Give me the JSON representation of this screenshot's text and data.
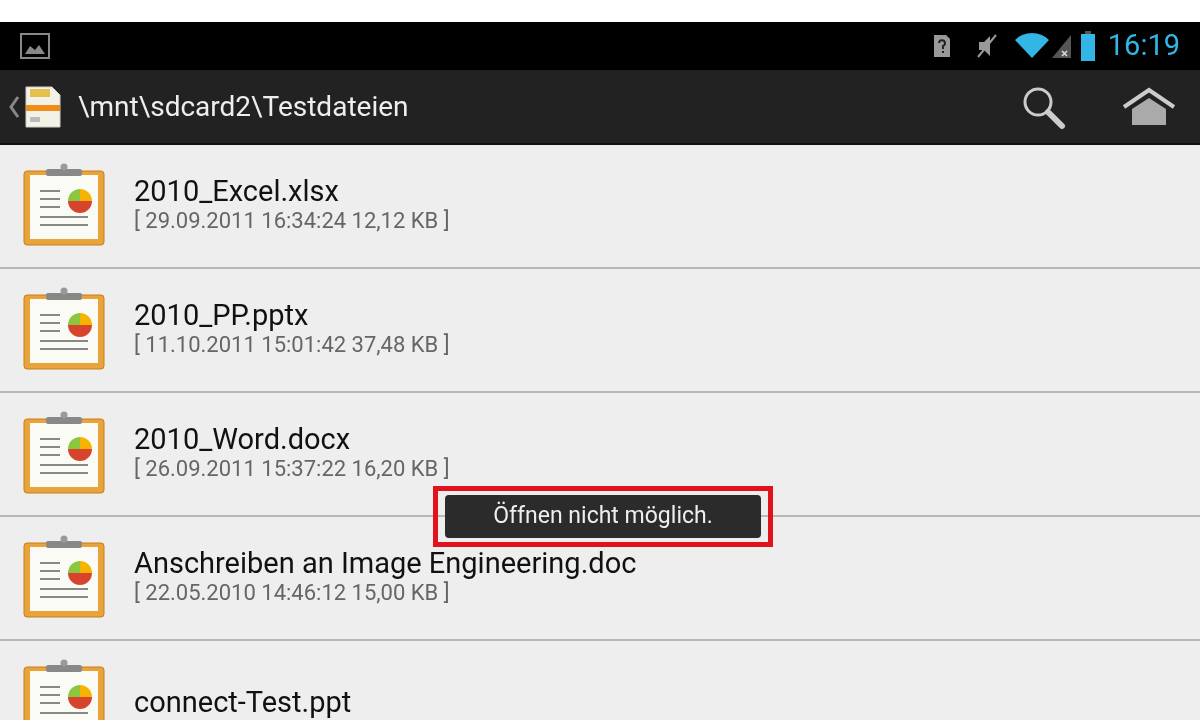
{
  "status_bar": {
    "time": "16:19"
  },
  "action_bar": {
    "path": "\\mnt\\sdcard2\\Testdateien"
  },
  "files": [
    {
      "name": "2010_Excel.xlsx",
      "meta": "[ 29.09.2011 16:34:24 12,12 KB ]"
    },
    {
      "name": "2010_PP.pptx",
      "meta": "[ 11.10.2011 15:01:42 37,48 KB ]"
    },
    {
      "name": "2010_Word.docx",
      "meta": "[ 26.09.2011 15:37:22 16,20 KB ]"
    },
    {
      "name": "Anschreiben an Image Engineering.doc",
      "meta": "[ 22.05.2010 14:46:12 15,00 KB ]"
    },
    {
      "name": "connect-Test.ppt"
    }
  ],
  "toast": {
    "message": "Öffnen nicht möglich.",
    "highlighted": true
  }
}
